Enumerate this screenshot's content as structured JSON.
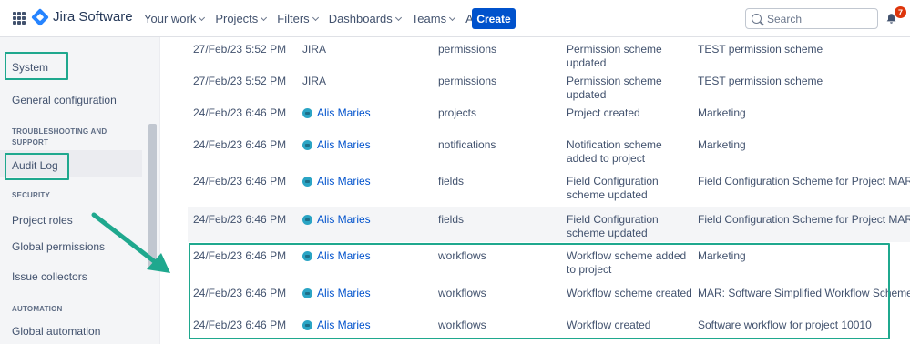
{
  "header": {
    "logo_text": "Jira Software",
    "nav": [
      {
        "label": "Your work"
      },
      {
        "label": "Projects"
      },
      {
        "label": "Filters"
      },
      {
        "label": "Dashboards"
      },
      {
        "label": "Teams"
      },
      {
        "label": "Apps"
      }
    ],
    "create_label": "Create",
    "search_placeholder": "Search",
    "notification_count": "7",
    "accent_color": "#0052cc"
  },
  "sidebar": {
    "system_label": "System",
    "general_config": "General configuration",
    "troubleshooting_section": "TROUBLESHOOTING AND SUPPORT",
    "audit_log": "Audit Log",
    "security_section": "SECURITY",
    "project_roles": "Project roles",
    "global_permissions": "Global permissions",
    "issue_collectors": "Issue collectors",
    "automation_section": "AUTOMATION",
    "global_automation": "Global automation"
  },
  "rows": [
    {
      "date": "27/Feb/23 5:52 PM",
      "user": "JIRA",
      "category": "permissions",
      "summary": "Permission scheme updated",
      "object": "TEST permission scheme"
    },
    {
      "date": "27/Feb/23 5:52 PM",
      "user": "JIRA",
      "category": "permissions",
      "summary": "Permission scheme updated",
      "object": "TEST permission scheme"
    },
    {
      "date": "24/Feb/23 6:46 PM",
      "user": "Alis Maries",
      "category": "projects",
      "summary": "Project created",
      "object": "Marketing"
    },
    {
      "date": "24/Feb/23 6:46 PM",
      "user": "Alis Maries",
      "category": "notifications",
      "summary": "Notification scheme added to project",
      "object": "Marketing"
    },
    {
      "date": "24/Feb/23 6:46 PM",
      "user": "Alis Maries",
      "category": "fields",
      "summary": "Field Configuration scheme updated",
      "object": "Field Configuration Scheme for Project MAR"
    },
    {
      "date": "24/Feb/23 6:46 PM",
      "user": "Alis Maries",
      "category": "fields",
      "summary": "Field Configuration scheme updated",
      "object": "Field Configuration Scheme for Project MAR"
    },
    {
      "date": "24/Feb/23 6:46 PM",
      "user": "Alis Maries",
      "category": "workflows",
      "summary": "Workflow scheme added to project",
      "object": "Marketing"
    },
    {
      "date": "24/Feb/23 6:46 PM",
      "user": "Alis Maries",
      "category": "workflows",
      "summary": "Workflow scheme created",
      "object": "MAR: Software Simplified Workflow Scheme"
    },
    {
      "date": "24/Feb/23 6:46 PM",
      "user": "Alis Maries",
      "category": "workflows",
      "summary": "Workflow created",
      "object": "Software workflow for project 10010"
    }
  ],
  "highlight_color": "#1fa88e"
}
